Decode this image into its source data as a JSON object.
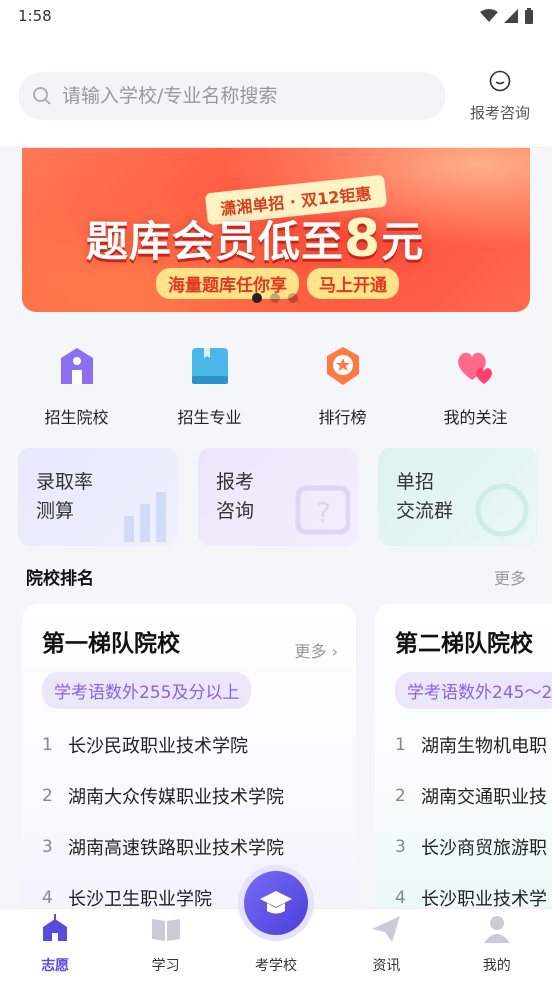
{
  "status_bar": {
    "time": "1:58"
  },
  "header": {
    "search_placeholder": "请输入学校/专业名称搜索",
    "consult_label": "报考咨询"
  },
  "banner": {
    "tag": "潇湘单招 · 双12钜惠",
    "main_text": "题库会员低至",
    "main_number": "8",
    "main_unit": "元",
    "sub_left": "海量题库任你享",
    "sub_right": "马上开通",
    "active_slide": 1,
    "total_slides": 3
  },
  "quick_nav": [
    {
      "label": "招生院校",
      "icon": "school-building-icon"
    },
    {
      "label": "招生专业",
      "icon": "book-icon"
    },
    {
      "label": "排行榜",
      "icon": "medal-star-icon"
    },
    {
      "label": "我的关注",
      "icon": "hearts-icon"
    }
  ],
  "feature_cards": [
    {
      "line1": "录取率",
      "line2": "测算"
    },
    {
      "line1": "报考",
      "line2": "咨询"
    },
    {
      "line1": "单招",
      "line2": "交流群"
    }
  ],
  "ranking": {
    "title": "院校排名",
    "more": "更多",
    "tiers": [
      {
        "title": "第一梯队院校",
        "more": "更多",
        "tag": "学考语数外255及分以上",
        "schools": [
          {
            "no": "1",
            "name": "长沙民政职业技术学院"
          },
          {
            "no": "2",
            "name": "湖南大众传媒职业技术学院"
          },
          {
            "no": "3",
            "name": "湖南高速铁路职业技术学院"
          },
          {
            "no": "4",
            "name": "长沙卫生职业学院"
          }
        ]
      },
      {
        "title": "第二梯队院校",
        "tag": "学考语数外245～2",
        "schools": [
          {
            "no": "1",
            "name": "湖南生物机电职"
          },
          {
            "no": "2",
            "name": "湖南交通职业技"
          },
          {
            "no": "3",
            "name": "长沙商贸旅游职"
          },
          {
            "no": "4",
            "name": "长沙职业技术学"
          }
        ]
      }
    ]
  },
  "tabbar": [
    {
      "label": "志愿",
      "active": true
    },
    {
      "label": "学习",
      "active": false
    },
    {
      "label": "考学校",
      "active": false
    },
    {
      "label": "资讯",
      "active": false
    },
    {
      "label": "我的",
      "active": false
    }
  ],
  "colors": {
    "accent": "#5b4ce0",
    "banner": "#ff5a3c"
  }
}
